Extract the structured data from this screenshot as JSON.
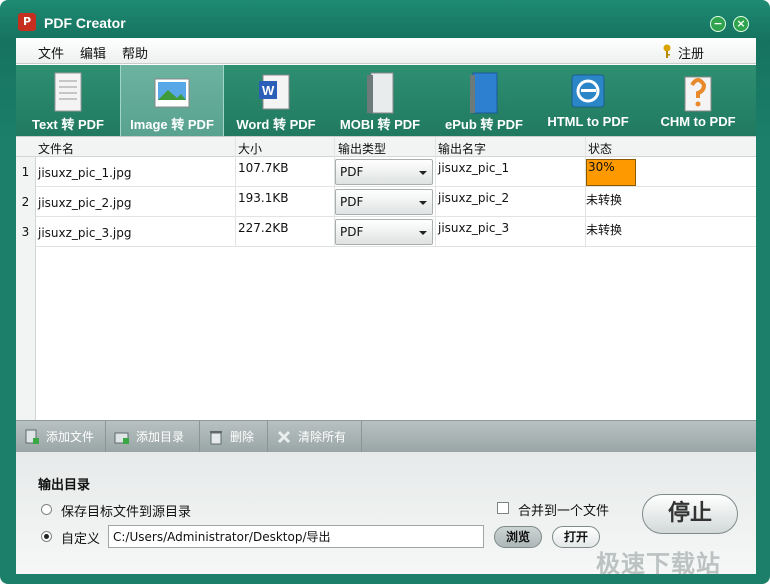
{
  "window": {
    "title": "PDF Creator",
    "min_symbol": "−",
    "close_symbol": "×",
    "app_icon_glyph": "P"
  },
  "menu": {
    "items": [
      "文件",
      "编辑",
      "帮助"
    ],
    "register_label": "注册"
  },
  "toolbar": {
    "buttons": [
      {
        "label": "Text 转 PDF",
        "icon": "text-doc-icon"
      },
      {
        "label": "Image 转 PDF",
        "icon": "image-icon",
        "active": true
      },
      {
        "label": "Word 转 PDF",
        "icon": "word-icon"
      },
      {
        "label": "MOBI 转 PDF",
        "icon": "mobi-book-icon"
      },
      {
        "label": "ePub 转 PDF",
        "icon": "epub-book-icon"
      },
      {
        "label": "HTML to PDF",
        "icon": "html-icon"
      },
      {
        "label": "CHM to PDF",
        "icon": "chm-icon"
      }
    ]
  },
  "grid": {
    "headers": {
      "name": "文件名",
      "size": "大小",
      "type": "输出类型",
      "out_name": "输出名字",
      "status": "状态"
    },
    "rows": [
      {
        "num": "1",
        "name": "jisuxz_pic_1.jpg",
        "size": "107.7KB",
        "type": "PDF",
        "out_name": "jisuxz_pic_1",
        "status": "30%",
        "progress": 0.3
      },
      {
        "num": "2",
        "name": "jisuxz_pic_2.jpg",
        "size": "193.1KB",
        "type": "PDF",
        "out_name": "jisuxz_pic_2",
        "status": "未转换"
      },
      {
        "num": "3",
        "name": "jisuxz_pic_3.jpg",
        "size": "227.2KB",
        "type": "PDF",
        "out_name": "jisuxz_pic_3",
        "status": "未转换"
      }
    ]
  },
  "actions": {
    "add_file": "添加文件",
    "add_dir": "添加目录",
    "delete": "删除",
    "clear_all": "清除所有"
  },
  "output": {
    "title": "输出目录",
    "option_source": "保存目标文件到源目录",
    "option_custom": "自定义",
    "selected": "custom",
    "path": "C:/Users/Administrator/Desktop/导出",
    "merge_label": "合并到一个文件",
    "merge_checked": false,
    "browse_label": "浏览",
    "open_label": "打开",
    "stop_label": "停止"
  },
  "watermark": "极速下载站",
  "colors": {
    "frame": "#1b7f6a",
    "progress": "#ff9900"
  }
}
